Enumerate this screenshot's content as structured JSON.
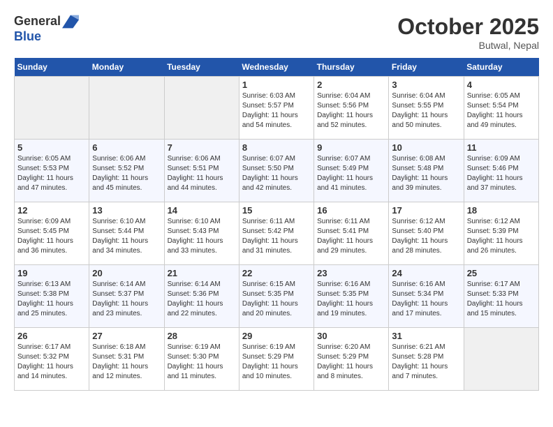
{
  "header": {
    "logo_line1": "General",
    "logo_line2": "Blue",
    "month_title": "October 2025",
    "location": "Butwal, Nepal"
  },
  "days_of_week": [
    "Sunday",
    "Monday",
    "Tuesday",
    "Wednesday",
    "Thursday",
    "Friday",
    "Saturday"
  ],
  "weeks": [
    [
      {
        "day": "",
        "info": ""
      },
      {
        "day": "",
        "info": ""
      },
      {
        "day": "",
        "info": ""
      },
      {
        "day": "1",
        "info": "Sunrise: 6:03 AM\nSunset: 5:57 PM\nDaylight: 11 hours\nand 54 minutes."
      },
      {
        "day": "2",
        "info": "Sunrise: 6:04 AM\nSunset: 5:56 PM\nDaylight: 11 hours\nand 52 minutes."
      },
      {
        "day": "3",
        "info": "Sunrise: 6:04 AM\nSunset: 5:55 PM\nDaylight: 11 hours\nand 50 minutes."
      },
      {
        "day": "4",
        "info": "Sunrise: 6:05 AM\nSunset: 5:54 PM\nDaylight: 11 hours\nand 49 minutes."
      }
    ],
    [
      {
        "day": "5",
        "info": "Sunrise: 6:05 AM\nSunset: 5:53 PM\nDaylight: 11 hours\nand 47 minutes."
      },
      {
        "day": "6",
        "info": "Sunrise: 6:06 AM\nSunset: 5:52 PM\nDaylight: 11 hours\nand 45 minutes."
      },
      {
        "day": "7",
        "info": "Sunrise: 6:06 AM\nSunset: 5:51 PM\nDaylight: 11 hours\nand 44 minutes."
      },
      {
        "day": "8",
        "info": "Sunrise: 6:07 AM\nSunset: 5:50 PM\nDaylight: 11 hours\nand 42 minutes."
      },
      {
        "day": "9",
        "info": "Sunrise: 6:07 AM\nSunset: 5:49 PM\nDaylight: 11 hours\nand 41 minutes."
      },
      {
        "day": "10",
        "info": "Sunrise: 6:08 AM\nSunset: 5:48 PM\nDaylight: 11 hours\nand 39 minutes."
      },
      {
        "day": "11",
        "info": "Sunrise: 6:09 AM\nSunset: 5:46 PM\nDaylight: 11 hours\nand 37 minutes."
      }
    ],
    [
      {
        "day": "12",
        "info": "Sunrise: 6:09 AM\nSunset: 5:45 PM\nDaylight: 11 hours\nand 36 minutes."
      },
      {
        "day": "13",
        "info": "Sunrise: 6:10 AM\nSunset: 5:44 PM\nDaylight: 11 hours\nand 34 minutes."
      },
      {
        "day": "14",
        "info": "Sunrise: 6:10 AM\nSunset: 5:43 PM\nDaylight: 11 hours\nand 33 minutes."
      },
      {
        "day": "15",
        "info": "Sunrise: 6:11 AM\nSunset: 5:42 PM\nDaylight: 11 hours\nand 31 minutes."
      },
      {
        "day": "16",
        "info": "Sunrise: 6:11 AM\nSunset: 5:41 PM\nDaylight: 11 hours\nand 29 minutes."
      },
      {
        "day": "17",
        "info": "Sunrise: 6:12 AM\nSunset: 5:40 PM\nDaylight: 11 hours\nand 28 minutes."
      },
      {
        "day": "18",
        "info": "Sunrise: 6:12 AM\nSunset: 5:39 PM\nDaylight: 11 hours\nand 26 minutes."
      }
    ],
    [
      {
        "day": "19",
        "info": "Sunrise: 6:13 AM\nSunset: 5:38 PM\nDaylight: 11 hours\nand 25 minutes."
      },
      {
        "day": "20",
        "info": "Sunrise: 6:14 AM\nSunset: 5:37 PM\nDaylight: 11 hours\nand 23 minutes."
      },
      {
        "day": "21",
        "info": "Sunrise: 6:14 AM\nSunset: 5:36 PM\nDaylight: 11 hours\nand 22 minutes."
      },
      {
        "day": "22",
        "info": "Sunrise: 6:15 AM\nSunset: 5:35 PM\nDaylight: 11 hours\nand 20 minutes."
      },
      {
        "day": "23",
        "info": "Sunrise: 6:16 AM\nSunset: 5:35 PM\nDaylight: 11 hours\nand 19 minutes."
      },
      {
        "day": "24",
        "info": "Sunrise: 6:16 AM\nSunset: 5:34 PM\nDaylight: 11 hours\nand 17 minutes."
      },
      {
        "day": "25",
        "info": "Sunrise: 6:17 AM\nSunset: 5:33 PM\nDaylight: 11 hours\nand 15 minutes."
      }
    ],
    [
      {
        "day": "26",
        "info": "Sunrise: 6:17 AM\nSunset: 5:32 PM\nDaylight: 11 hours\nand 14 minutes."
      },
      {
        "day": "27",
        "info": "Sunrise: 6:18 AM\nSunset: 5:31 PM\nDaylight: 11 hours\nand 12 minutes."
      },
      {
        "day": "28",
        "info": "Sunrise: 6:19 AM\nSunset: 5:30 PM\nDaylight: 11 hours\nand 11 minutes."
      },
      {
        "day": "29",
        "info": "Sunrise: 6:19 AM\nSunset: 5:29 PM\nDaylight: 11 hours\nand 10 minutes."
      },
      {
        "day": "30",
        "info": "Sunrise: 6:20 AM\nSunset: 5:29 PM\nDaylight: 11 hours\nand 8 minutes."
      },
      {
        "day": "31",
        "info": "Sunrise: 6:21 AM\nSunset: 5:28 PM\nDaylight: 11 hours\nand 7 minutes."
      },
      {
        "day": "",
        "info": ""
      }
    ]
  ]
}
